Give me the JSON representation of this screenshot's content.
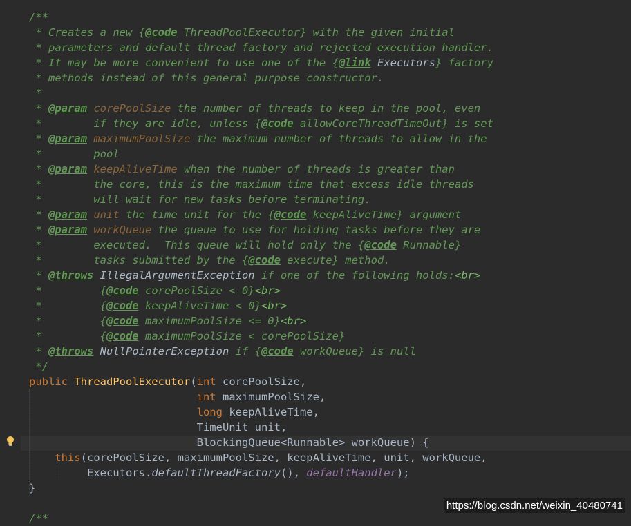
{
  "editor": {
    "lines": [
      [
        {
          "t": "/**",
          "s": "c"
        }
      ],
      [
        {
          "t": " * Creates a new {",
          "s": "c"
        },
        {
          "t": "@code",
          "s": "t"
        },
        {
          "t": " ThreadPoolExecutor} with the given initial",
          "s": "c"
        }
      ],
      [
        {
          "t": " * parameters and default thread factory and rejected execution handler.",
          "s": "c"
        }
      ],
      [
        {
          "t": " * It may be more convenient to use one of the {",
          "s": "c"
        },
        {
          "t": "@link",
          "s": "t"
        },
        {
          "t": " ",
          "s": "c"
        },
        {
          "t": "Executors",
          "s": "lr"
        },
        {
          "t": "} factory",
          "s": "c"
        }
      ],
      [
        {
          "t": " * methods instead of this general purpose constructor.",
          "s": "c"
        }
      ],
      [
        {
          "t": " *",
          "s": "c"
        }
      ],
      [
        {
          "t": " * ",
          "s": "c"
        },
        {
          "t": "@param",
          "s": "t"
        },
        {
          "t": " ",
          "s": "c"
        },
        {
          "t": "corePoolSize",
          "s": "pn"
        },
        {
          "t": " the number of threads to keep in the pool, even",
          "s": "c"
        }
      ],
      [
        {
          "t": " *        if they are idle, unless {",
          "s": "c"
        },
        {
          "t": "@code",
          "s": "t"
        },
        {
          "t": " allowCoreThreadTimeOut} is set",
          "s": "c"
        }
      ],
      [
        {
          "t": " * ",
          "s": "c"
        },
        {
          "t": "@param",
          "s": "t"
        },
        {
          "t": " ",
          "s": "c"
        },
        {
          "t": "maximumPoolSize",
          "s": "pn"
        },
        {
          "t": " the maximum number of threads to allow in the",
          "s": "c"
        }
      ],
      [
        {
          "t": " *        pool",
          "s": "c"
        }
      ],
      [
        {
          "t": " * ",
          "s": "c"
        },
        {
          "t": "@param",
          "s": "t"
        },
        {
          "t": " ",
          "s": "c"
        },
        {
          "t": "keepAliveTime",
          "s": "pn"
        },
        {
          "t": " when the number of threads is greater than",
          "s": "c"
        }
      ],
      [
        {
          "t": " *        the core, this is the maximum time that excess idle threads",
          "s": "c"
        }
      ],
      [
        {
          "t": " *        will wait for new tasks before terminating.",
          "s": "c"
        }
      ],
      [
        {
          "t": " * ",
          "s": "c"
        },
        {
          "t": "@param",
          "s": "t"
        },
        {
          "t": " ",
          "s": "c"
        },
        {
          "t": "unit",
          "s": "pn"
        },
        {
          "t": " the time unit for the {",
          "s": "c"
        },
        {
          "t": "@code",
          "s": "t"
        },
        {
          "t": " keepAliveTime} argument",
          "s": "c"
        }
      ],
      [
        {
          "t": " * ",
          "s": "c"
        },
        {
          "t": "@param",
          "s": "t"
        },
        {
          "t": " ",
          "s": "c"
        },
        {
          "t": "workQueue",
          "s": "pn"
        },
        {
          "t": " the queue to use for holding tasks before they are",
          "s": "c"
        }
      ],
      [
        {
          "t": " *        executed.  This queue will hold only the {",
          "s": "c"
        },
        {
          "t": "@code",
          "s": "t"
        },
        {
          "t": " Runnable}",
          "s": "c"
        }
      ],
      [
        {
          "t": " *        tasks submitted by the {",
          "s": "c"
        },
        {
          "t": "@code",
          "s": "t"
        },
        {
          "t": " execute} method.",
          "s": "c"
        }
      ],
      [
        {
          "t": " * ",
          "s": "c"
        },
        {
          "t": "@throws",
          "s": "t"
        },
        {
          "t": " ",
          "s": "c"
        },
        {
          "t": "IllegalArgumentException",
          "s": "lr"
        },
        {
          "t": " if one of the following holds:",
          "s": "c"
        },
        {
          "t": "<br>",
          "s": "hm"
        }
      ],
      [
        {
          "t": " *         {",
          "s": "c"
        },
        {
          "t": "@code",
          "s": "t"
        },
        {
          "t": " corePoolSize < 0}",
          "s": "c"
        },
        {
          "t": "<br>",
          "s": "hm"
        }
      ],
      [
        {
          "t": " *         {",
          "s": "c"
        },
        {
          "t": "@code",
          "s": "t"
        },
        {
          "t": " keepAliveTime < 0}",
          "s": "c"
        },
        {
          "t": "<br>",
          "s": "hm"
        }
      ],
      [
        {
          "t": " *         {",
          "s": "c"
        },
        {
          "t": "@code",
          "s": "t"
        },
        {
          "t": " maximumPoolSize <= 0}",
          "s": "c"
        },
        {
          "t": "<br>",
          "s": "hm"
        }
      ],
      [
        {
          "t": " *         {",
          "s": "c"
        },
        {
          "t": "@code",
          "s": "t"
        },
        {
          "t": " maximumPoolSize < corePoolSize}",
          "s": "c"
        }
      ],
      [
        {
          "t": " * ",
          "s": "c"
        },
        {
          "t": "@throws",
          "s": "t"
        },
        {
          "t": " ",
          "s": "c"
        },
        {
          "t": "NullPointerException",
          "s": "lr"
        },
        {
          "t": " if {",
          "s": "c"
        },
        {
          "t": "@code",
          "s": "t"
        },
        {
          "t": " workQueue} is null",
          "s": "c"
        }
      ],
      [
        {
          "t": " */",
          "s": "c"
        }
      ],
      [
        {
          "t": "public ",
          "s": "k"
        },
        {
          "t": "ThreadPoolExecutor",
          "s": "f"
        },
        {
          "t": "(",
          "s": "p"
        },
        {
          "t": "int ",
          "s": "k"
        },
        {
          "t": "corePoolSize,",
          "s": "p"
        }
      ],
      [
        {
          "t": "                          ",
          "s": "p"
        },
        {
          "t": "int ",
          "s": "k"
        },
        {
          "t": "maximumPoolSize,",
          "s": "p"
        }
      ],
      [
        {
          "t": "                          ",
          "s": "p"
        },
        {
          "t": "long ",
          "s": "k"
        },
        {
          "t": "keepAliveTime,",
          "s": "p"
        }
      ],
      [
        {
          "t": "                          TimeUnit unit,",
          "s": "p"
        }
      ],
      [
        {
          "t": "                          BlockingQueue<Runnable> workQueue) {",
          "s": "p"
        }
      ],
      [
        {
          "t": "    ",
          "s": "p"
        },
        {
          "t": "this",
          "s": "k"
        },
        {
          "t": "(corePoolSize, maximumPoolSize, keepAliveTime, unit, workQueue,",
          "s": "p"
        }
      ],
      [
        {
          "t": "         Executors.",
          "s": "p"
        },
        {
          "t": "defaultThreadFactory",
          "s": "st"
        },
        {
          "t": "(), ",
          "s": "p"
        },
        {
          "t": "defaultHandler",
          "s": "fd"
        },
        {
          "t": ");",
          "s": "p"
        }
      ],
      [
        {
          "t": "}",
          "s": "p"
        }
      ],
      [],
      [
        {
          "t": "/**",
          "s": "c"
        }
      ]
    ]
  },
  "gutter": {
    "intention_icon": "lightbulb-icon"
  },
  "watermark": {
    "text": "https://blog.csdn.net/weixin_40480741"
  }
}
